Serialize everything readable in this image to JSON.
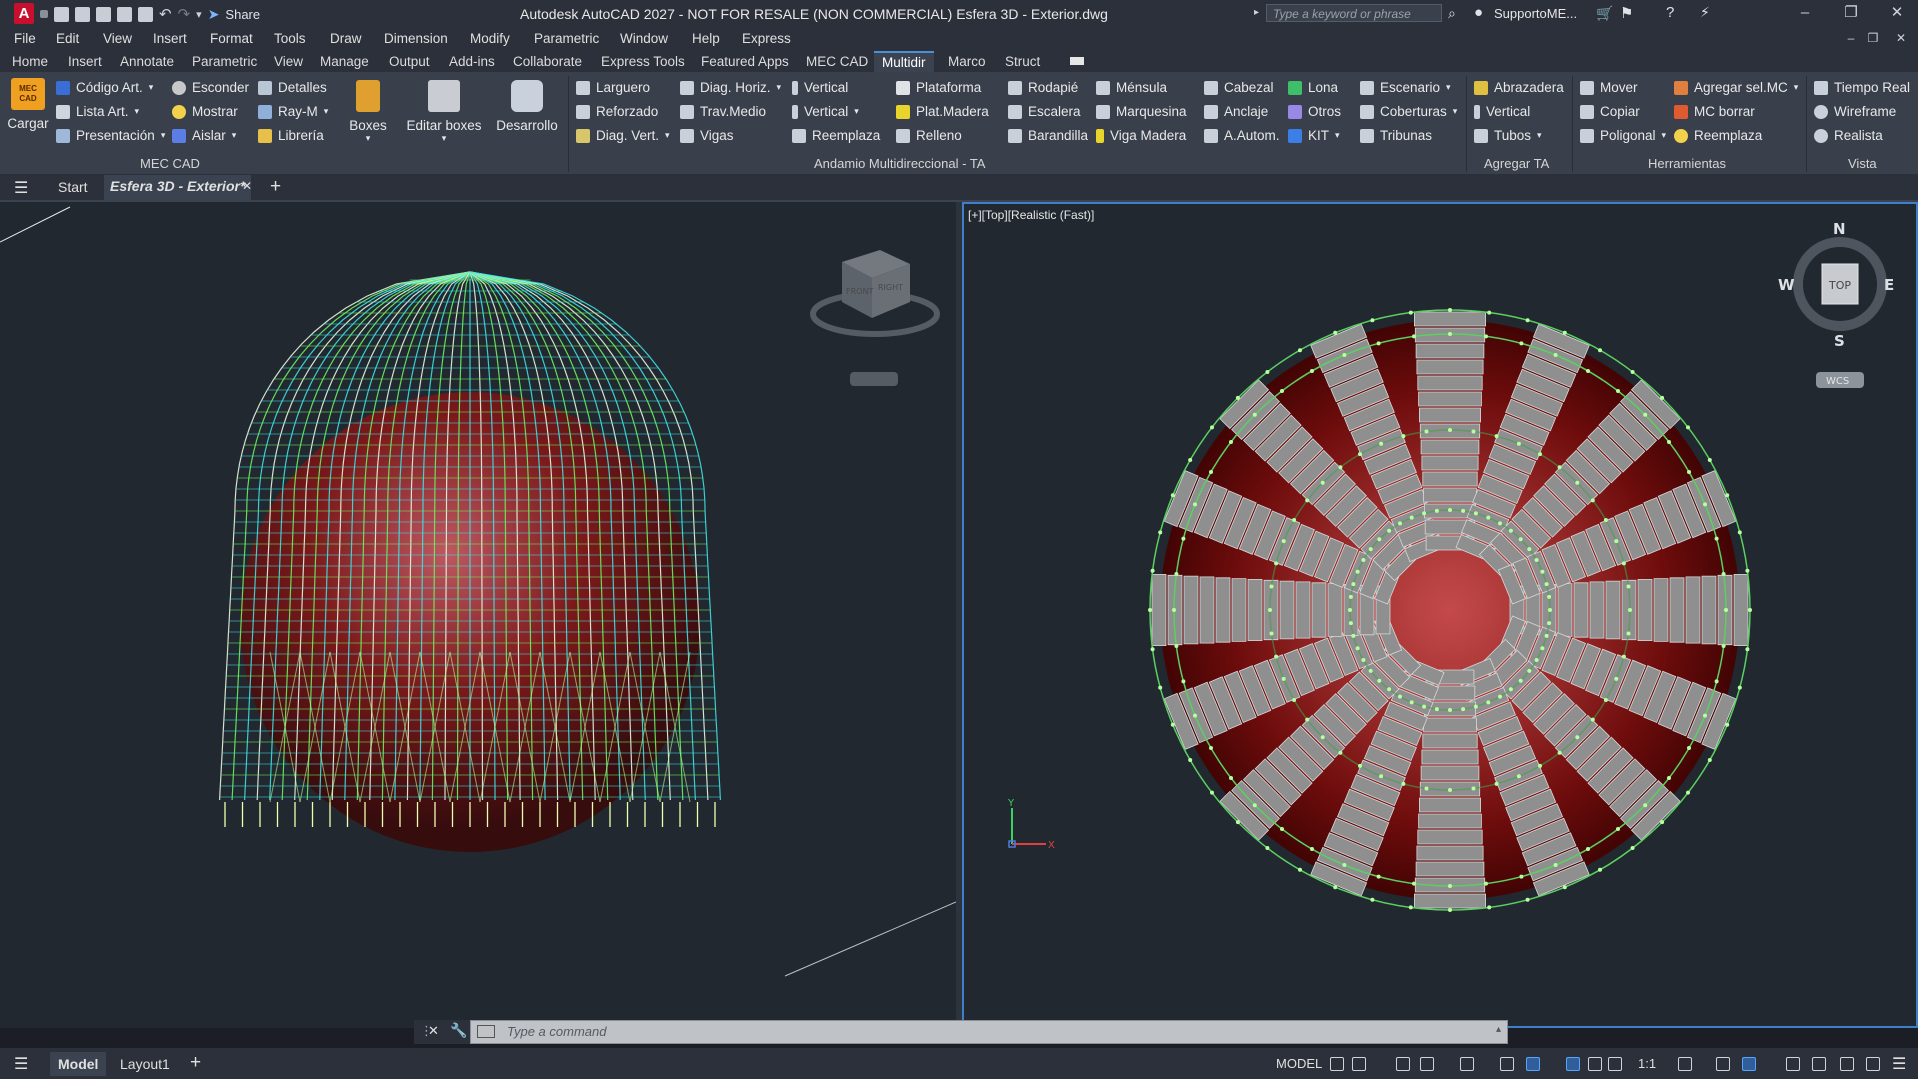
{
  "app": {
    "title": "Autodesk AutoCAD 2027 - NOT FOR RESALE (NON COMMERCIAL)     Esfera 3D - Exterior.dwg",
    "logo_letter": "A",
    "share_label": "Share",
    "search_placeholder": "Type a keyword or phrase",
    "user_label": "SupportoME...",
    "window_controls": [
      "–",
      "❐",
      "✕"
    ],
    "doc_controls": [
      "–",
      "❐",
      "✕"
    ]
  },
  "menu": [
    "File",
    "Edit",
    "View",
    "Insert",
    "Format",
    "Tools",
    "Draw",
    "Dimension",
    "Modify",
    "Parametric",
    "Window",
    "Help",
    "Express"
  ],
  "ribbon_tabs": [
    "Home",
    "Insert",
    "Annotate",
    "Parametric",
    "View",
    "Manage",
    "Output",
    "Add-ins",
    "Collaborate",
    "Express Tools",
    "Featured Apps",
    "MEC CAD",
    "Multidir",
    "Marco",
    "Struct"
  ],
  "ribbon_active_tab": "Multidir",
  "ribbon": {
    "mec_cad": {
      "label": "MEC CAD",
      "cargar": "Cargar",
      "cargar_logo": "MEC CAD",
      "col1": [
        "Código Art.",
        "Lista Art.",
        "Presentación"
      ],
      "col2": [
        "Esconder",
        "Mostrar",
        "Aislar"
      ],
      "col3": [
        "Detalles",
        "Ray-M",
        "Librería"
      ],
      "boxes": "Boxes",
      "editar_boxes": "Editar boxes",
      "desarrollo": "Desarrollo"
    },
    "andamio": {
      "label": "Andamio Multidireccional - TA",
      "col1": [
        "Larguero",
        "Reforzado",
        "Diag. Vert."
      ],
      "col2": [
        "Diag. Horiz.",
        "Trav.Medio",
        "Vigas"
      ],
      "col3": [
        "Vertical",
        "Vertical",
        "Reemplaza"
      ],
      "col4": [
        "Plataforma",
        "Plat.Madera",
        "Relleno"
      ],
      "col5": [
        "Rodapié",
        "Escalera",
        "Barandilla"
      ],
      "col6": [
        "Ménsula",
        "Marquesina",
        "Viga Madera"
      ],
      "col7": [
        "Cabezal",
        "Anclaje",
        "A.Autom."
      ],
      "col8": [
        "Lona",
        "Otros",
        "KIT"
      ],
      "col9": [
        "Escenario",
        "Coberturas",
        "Tribunas"
      ]
    },
    "agregar_ta": {
      "label": "Agregar TA",
      "items": [
        "Abrazadera",
        "Vertical",
        "Tubos"
      ]
    },
    "herramientas": {
      "label": "Herramientas",
      "col1": [
        "Mover",
        "Copiar",
        "Poligonal"
      ],
      "col2": [
        "Agregar sel.MC",
        "MC borrar",
        "Reemplaza"
      ]
    },
    "vista": {
      "label": "Vista",
      "items": [
        "Tiempo Real",
        "Wireframe",
        "Realista"
      ]
    }
  },
  "doc_tabs": {
    "start": "Start",
    "active": "Esfera 3D - Exterior*",
    "close": "✕",
    "add": "+"
  },
  "viewport_right": {
    "label": "[+][Top][Realistic (Fast)]",
    "compass": {
      "n": "N",
      "s": "S",
      "e": "E",
      "w": "W",
      "top": "TOP"
    },
    "wcs": "WCS"
  },
  "viewport_left": {
    "viewcube_faces": [
      "FRONT",
      "RIGHT"
    ]
  },
  "command_line": {
    "placeholder": "Type a command"
  },
  "status_bar": {
    "tabs": [
      "Model",
      "Layout1"
    ],
    "add": "+",
    "model_label": "MODEL",
    "scale": "1:1"
  },
  "colors": {
    "accent": "#4a90d9",
    "wire_cyan": "#3fe0e0",
    "wire_green": "#6cf060",
    "sphere_red": "#7a0c0c",
    "board_gray": "#8f8f8f"
  }
}
